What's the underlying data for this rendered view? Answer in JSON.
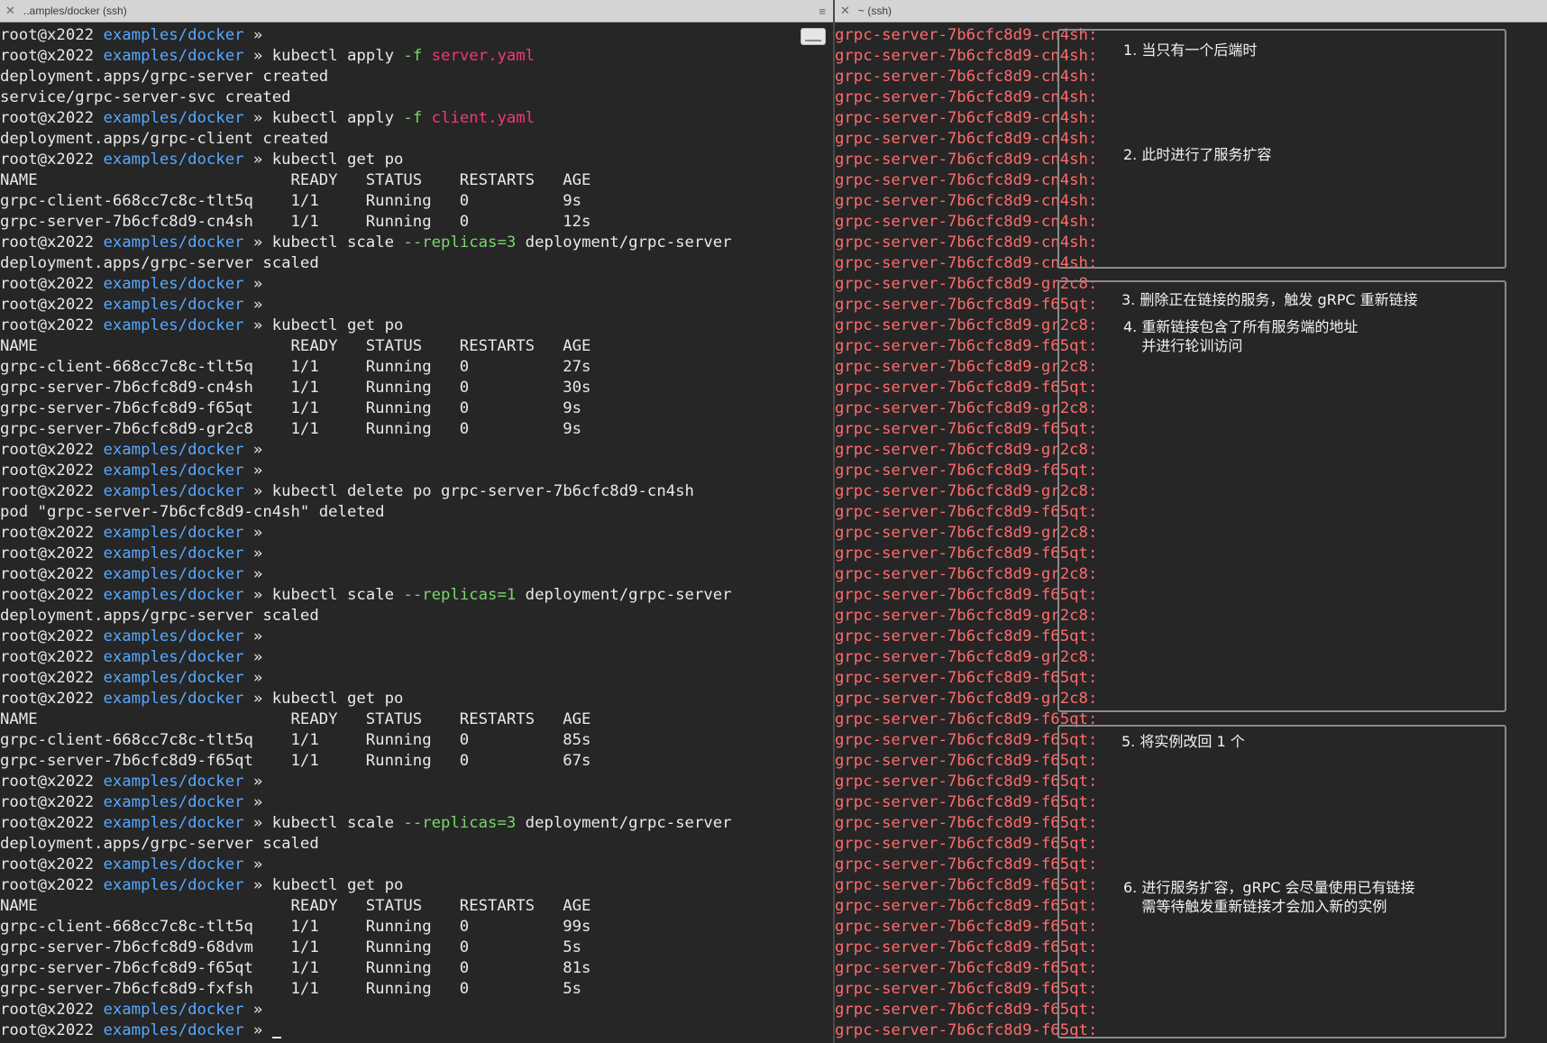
{
  "left": {
    "tab_title": "..amples/docker (ssh)",
    "close_glyph": "✕",
    "menu_glyph": "≡",
    "prompt_user": "root@x2022",
    "prompt_dir": "examples/docker",
    "prompt_arrow": " » ",
    "lines": [
      {
        "t": "p",
        "cmd": []
      },
      {
        "t": "p",
        "cmd": [
          {
            "s": "kubectl apply "
          },
          {
            "s": "-f",
            "c": "flag"
          },
          {
            "s": " "
          },
          {
            "s": "server.yaml",
            "c": "fname"
          }
        ]
      },
      {
        "t": "o",
        "text": "deployment.apps/grpc-server created"
      },
      {
        "t": "o",
        "text": "service/grpc-server-svc created"
      },
      {
        "t": "p",
        "cmd": [
          {
            "s": "kubectl apply "
          },
          {
            "s": "-f",
            "c": "flag"
          },
          {
            "s": " "
          },
          {
            "s": "client.yaml",
            "c": "fname"
          }
        ]
      },
      {
        "t": "o",
        "text": "deployment.apps/grpc-client created"
      },
      {
        "t": "p",
        "cmd": [
          {
            "s": "kubectl get po"
          }
        ]
      },
      {
        "t": "o",
        "text": "NAME                           READY   STATUS    RESTARTS   AGE"
      },
      {
        "t": "o",
        "text": "grpc-client-668cc7c8c-tlt5q    1/1     Running   0          9s"
      },
      {
        "t": "o",
        "text": "grpc-server-7b6cfc8d9-cn4sh    1/1     Running   0          12s"
      },
      {
        "t": "p",
        "cmd": [
          {
            "s": "kubectl scale "
          },
          {
            "s": "--replicas=3",
            "c": "flag"
          },
          {
            "s": " deployment/grpc-server"
          }
        ]
      },
      {
        "t": "o",
        "text": "deployment.apps/grpc-server scaled"
      },
      {
        "t": "p",
        "cmd": []
      },
      {
        "t": "p",
        "cmd": []
      },
      {
        "t": "p",
        "cmd": [
          {
            "s": "kubectl get po"
          }
        ]
      },
      {
        "t": "o",
        "text": "NAME                           READY   STATUS    RESTARTS   AGE"
      },
      {
        "t": "o",
        "text": "grpc-client-668cc7c8c-tlt5q    1/1     Running   0          27s"
      },
      {
        "t": "o",
        "text": "grpc-server-7b6cfc8d9-cn4sh    1/1     Running   0          30s"
      },
      {
        "t": "o",
        "text": "grpc-server-7b6cfc8d9-f65qt    1/1     Running   0          9s"
      },
      {
        "t": "o",
        "text": "grpc-server-7b6cfc8d9-gr2c8    1/1     Running   0          9s"
      },
      {
        "t": "p",
        "cmd": []
      },
      {
        "t": "p",
        "cmd": []
      },
      {
        "t": "p",
        "cmd": [
          {
            "s": "kubectl delete po grpc-server-7b6cfc8d9-cn4sh"
          }
        ]
      },
      {
        "t": "o",
        "text": "pod \"grpc-server-7b6cfc8d9-cn4sh\" deleted"
      },
      {
        "t": "p",
        "cmd": []
      },
      {
        "t": "p",
        "cmd": []
      },
      {
        "t": "p",
        "cmd": []
      },
      {
        "t": "p",
        "cmd": [
          {
            "s": "kubectl scale "
          },
          {
            "s": "--replicas=1",
            "c": "flag"
          },
          {
            "s": " deployment/grpc-server"
          }
        ]
      },
      {
        "t": "o",
        "text": "deployment.apps/grpc-server scaled"
      },
      {
        "t": "p",
        "cmd": []
      },
      {
        "t": "p",
        "cmd": []
      },
      {
        "t": "p",
        "cmd": []
      },
      {
        "t": "p",
        "cmd": [
          {
            "s": "kubectl get po"
          }
        ]
      },
      {
        "t": "o",
        "text": "NAME                           READY   STATUS    RESTARTS   AGE"
      },
      {
        "t": "o",
        "text": "grpc-client-668cc7c8c-tlt5q    1/1     Running   0          85s"
      },
      {
        "t": "o",
        "text": "grpc-server-7b6cfc8d9-f65qt    1/1     Running   0          67s"
      },
      {
        "t": "p",
        "cmd": []
      },
      {
        "t": "p",
        "cmd": []
      },
      {
        "t": "p",
        "cmd": [
          {
            "s": "kubectl scale "
          },
          {
            "s": "--replicas=3",
            "c": "flag"
          },
          {
            "s": " deployment/grpc-server"
          }
        ]
      },
      {
        "t": "o",
        "text": "deployment.apps/grpc-server scaled"
      },
      {
        "t": "p",
        "cmd": []
      },
      {
        "t": "p",
        "cmd": [
          {
            "s": "kubectl get po"
          }
        ]
      },
      {
        "t": "o",
        "text": "NAME                           READY   STATUS    RESTARTS   AGE"
      },
      {
        "t": "o",
        "text": "grpc-client-668cc7c8c-tlt5q    1/1     Running   0          99s"
      },
      {
        "t": "o",
        "text": "grpc-server-7b6cfc8d9-68dvm    1/1     Running   0          5s"
      },
      {
        "t": "o",
        "text": "grpc-server-7b6cfc8d9-f65qt    1/1     Running   0          81s"
      },
      {
        "t": "o",
        "text": "grpc-server-7b6cfc8d9-fxfsh    1/1     Running   0          5s"
      },
      {
        "t": "p",
        "cmd": []
      },
      {
        "t": "p",
        "cmd": [],
        "cursor": true
      }
    ]
  },
  "right": {
    "tab_title": "~ (ssh)",
    "close_glyph": "✕",
    "log_prefix": "grpc-server-7b6cfc8d9-",
    "log_suffix": ":",
    "log_pods": [
      "cn4sh",
      "cn4sh",
      "cn4sh",
      "cn4sh",
      "cn4sh",
      "cn4sh",
      "cn4sh",
      "cn4sh",
      "cn4sh",
      "cn4sh",
      "cn4sh",
      "cn4sh",
      "gr2c8",
      "f65qt",
      "gr2c8",
      "f65qt",
      "gr2c8",
      "f65qt",
      "gr2c8",
      "f65qt",
      "gr2c8",
      "f65qt",
      "gr2c8",
      "f65qt",
      "gr2c8",
      "f65qt",
      "gr2c8",
      "f65qt",
      "gr2c8",
      "f65qt",
      "gr2c8",
      "f65qt",
      "gr2c8",
      "f65qt",
      "f65qt",
      "f65qt",
      "f65qt",
      "f65qt",
      "f65qt",
      "f65qt",
      "f65qt",
      "f65qt",
      "f65qt",
      "f65qt",
      "f65qt",
      "f65qt",
      "f65qt",
      "f65qt",
      "f65qt"
    ],
    "annotations": [
      "1. 当只有一个后端时",
      "2. 此时进行了服务扩容",
      "3. 删除正在链接的服务，触发 gRPC 重新链接",
      "4. 重新链接包含了所有服务端的地址\n    并进行轮训访问",
      "5. 将实例改回 1 个",
      "6. 进行服务扩容，gRPC 会尽量使用已有链接\n    需等待触发重新链接才会加入新的实例"
    ]
  },
  "colors": {
    "background": "#262626",
    "text": "#e9e9e9",
    "prompt_dir": "#57a8ff",
    "flag": "#7ad66c",
    "filename": "#f0397a",
    "log": "#ff6b6b",
    "box_border": "#8b8b8b"
  }
}
